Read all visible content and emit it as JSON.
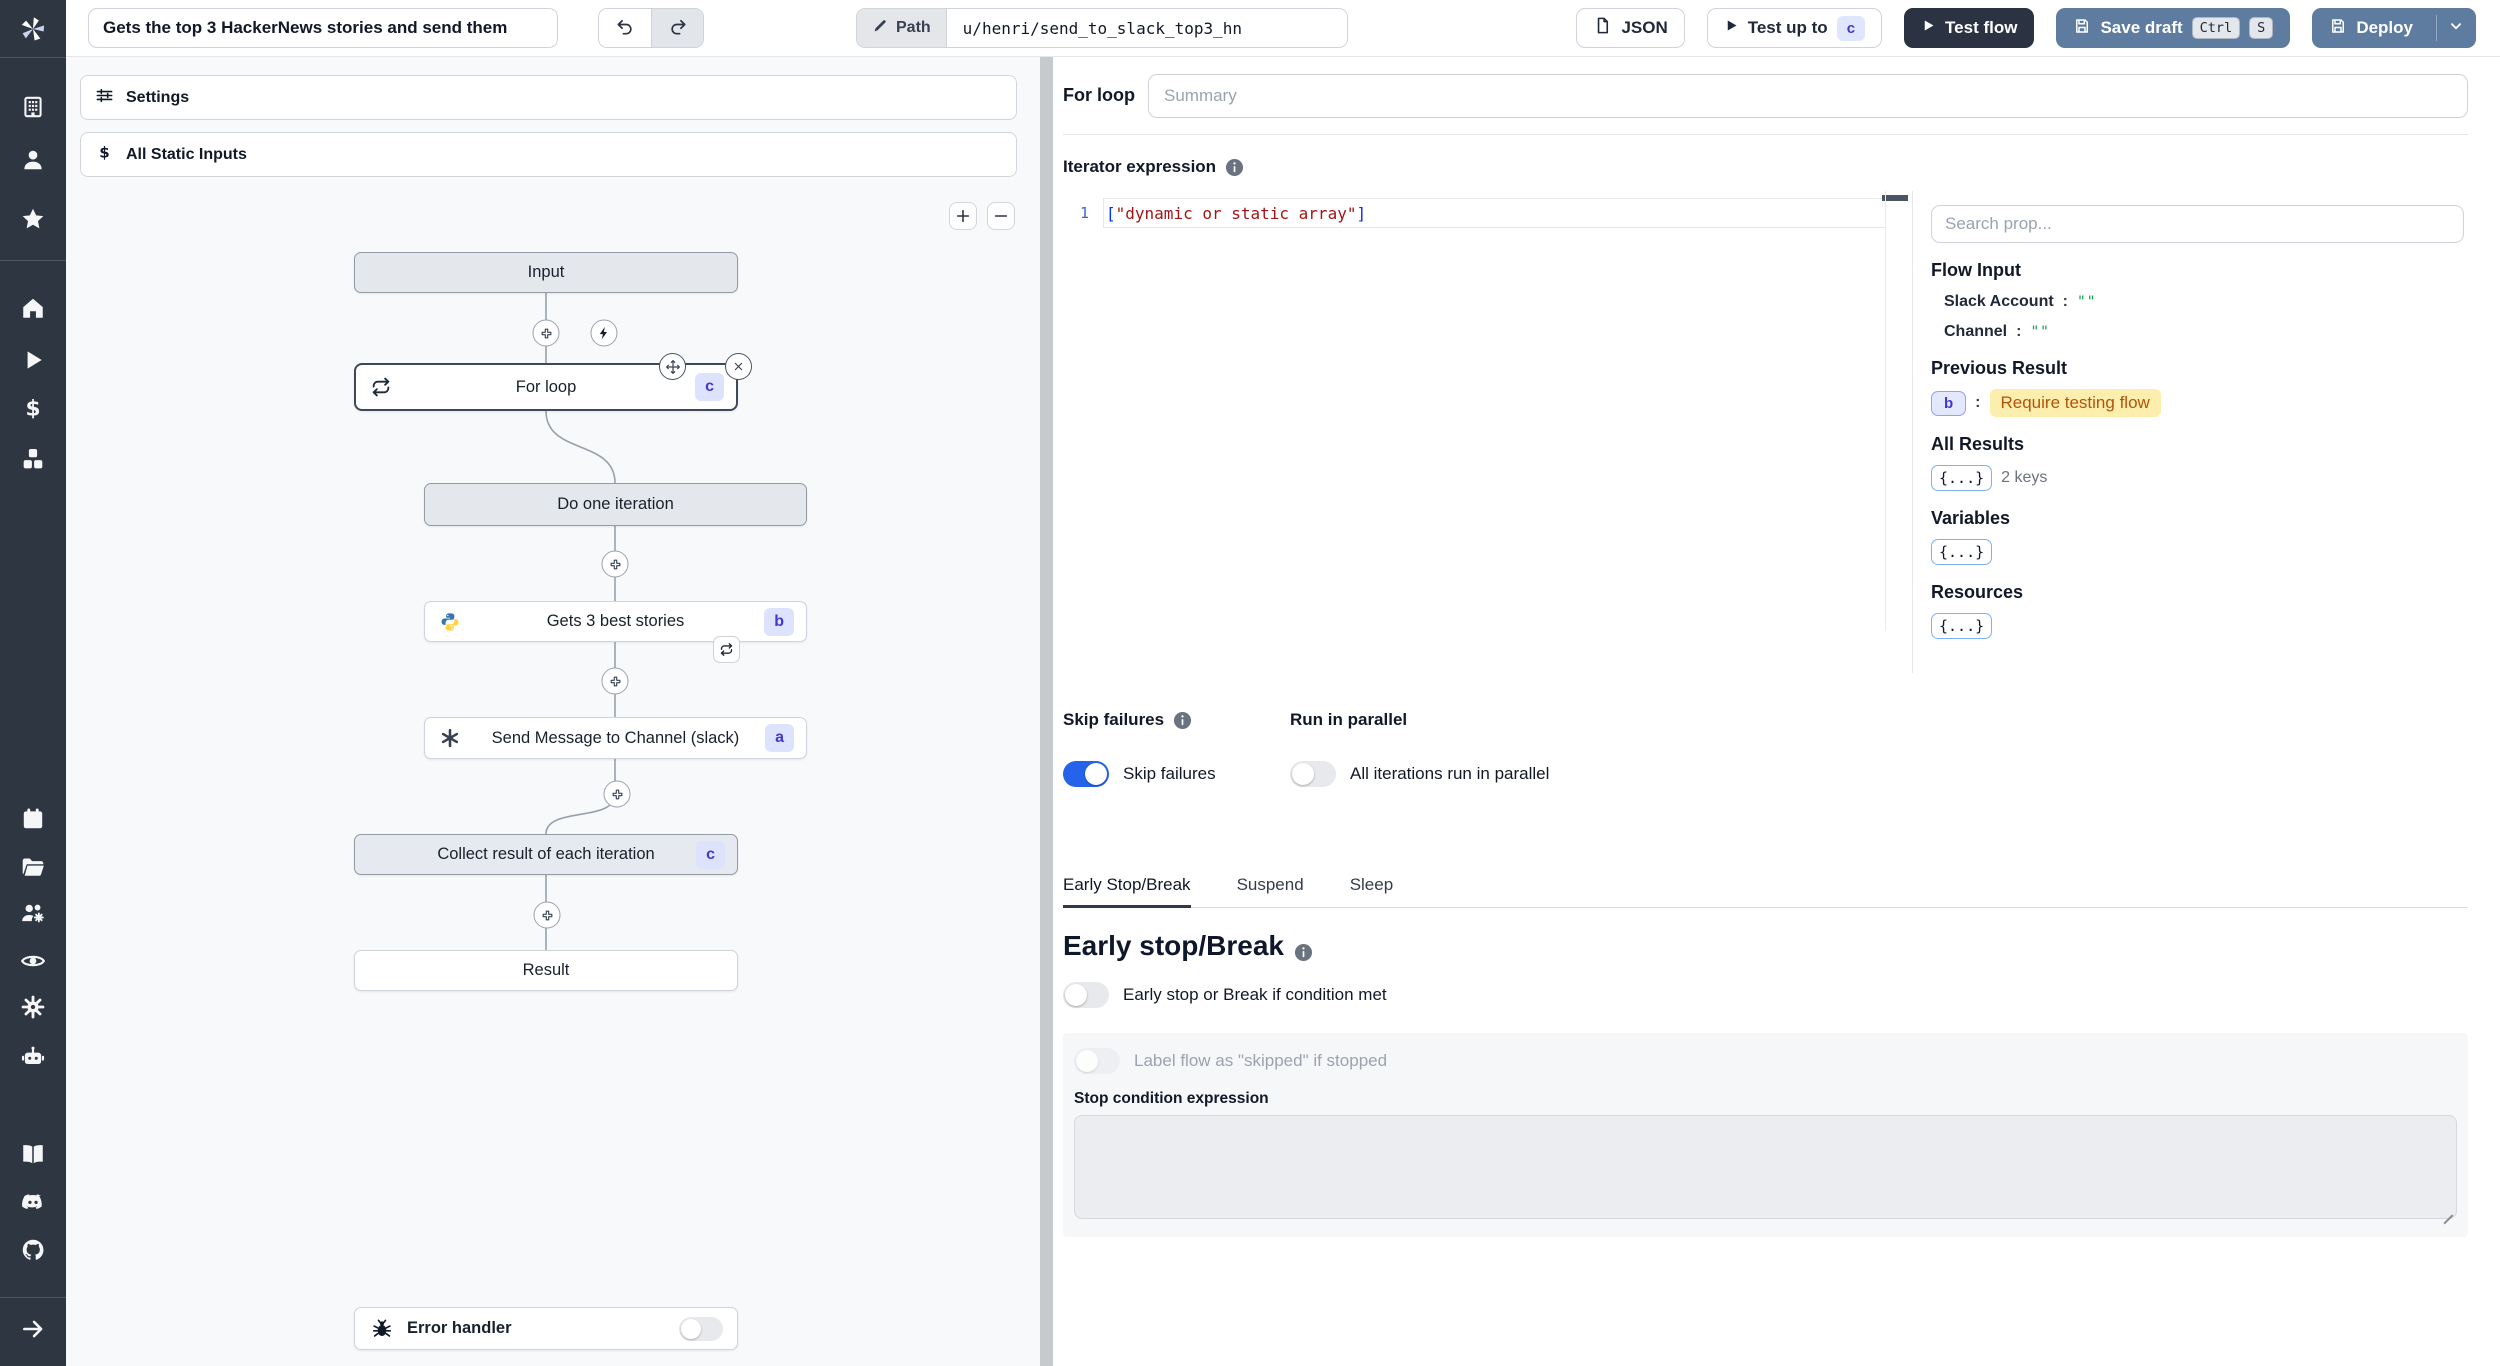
{
  "topbar": {
    "title_value": "Gets the top 3 HackerNews stories and send them",
    "path_label": "Path",
    "path_value": "u/henri/send_to_slack_top3_hn",
    "json_button": "JSON",
    "test_up_to": "Test up to",
    "test_up_to_badge": "c",
    "test_flow": "Test flow",
    "save_draft": "Save draft",
    "save_draft_keys": [
      "Ctrl",
      "S"
    ],
    "deploy": "Deploy"
  },
  "sidebar": {
    "icons": [
      "windmill-logo",
      "building",
      "user",
      "star",
      "home",
      "play",
      "dollar",
      "boxes",
      "calendar",
      "folder",
      "user-group-gear",
      "eye",
      "gear",
      "robot",
      "book",
      "discord",
      "github",
      "arrow-right"
    ]
  },
  "flow": {
    "settings_label": "Settings",
    "static_inputs_label": "All Static Inputs",
    "nodes": {
      "input": "Input",
      "for_loop": {
        "label": "For loop",
        "badge": "c"
      },
      "do_one_iteration": "Do one iteration",
      "gets_stories": {
        "label": "Gets 3 best stories",
        "badge": "b"
      },
      "send_message": {
        "label": "Send Message to Channel (slack)",
        "badge": "a"
      },
      "collect": {
        "label": "Collect result of each iteration",
        "badge": "c"
      },
      "result": "Result"
    },
    "error_handler_label": "Error handler"
  },
  "inspector": {
    "node_title": "For loop",
    "summary_placeholder": "Summary",
    "iterator_label": "Iterator expression",
    "code": {
      "line_no": "1",
      "open": "[",
      "str": "\"dynamic or static array\"",
      "close": "]"
    },
    "prop_picker": {
      "search_placeholder": "Search prop...",
      "flow_input_label": "Flow Input",
      "colon": ":",
      "props": [
        {
          "name": "Slack Account",
          "value": "\"\""
        },
        {
          "name": "Channel",
          "value": "\"\""
        }
      ],
      "previous_result_label": "Previous Result",
      "prev_badge": "b",
      "prev_value": "Require testing flow",
      "all_results_label": "All Results",
      "object_chip": "{...}",
      "all_results_keys": "2 keys",
      "variables_label": "Variables",
      "resources_label": "Resources"
    },
    "skip_failures_label": "Skip failures",
    "run_in_parallel_label": "Run in parallel",
    "skip_failures_toggle_label": "Skip failures",
    "parallel_toggle_label": "All iterations run in parallel",
    "tabs": [
      "Early Stop/Break",
      "Suspend",
      "Sleep"
    ],
    "early_stop": {
      "heading": "Early stop/Break",
      "toggle_label": "Early stop or Break if condition met",
      "skipped_toggle_label": "Label flow as \"skipped\" if stopped",
      "stop_condition_label": "Stop condition expression"
    }
  },
  "colors": {
    "accent_blue": "#2563eb",
    "steel_blue": "#5e7ca0",
    "sidebar_dark": "#2e3642",
    "badge_bg": "#dde3fd",
    "badge_text": "#4338ca",
    "highlight_bg": "#fcefad",
    "highlight_text": "#b45309",
    "code_string": "#a31515",
    "code_bracket": "#0431fa",
    "prop_value_green": "#16a34a"
  }
}
